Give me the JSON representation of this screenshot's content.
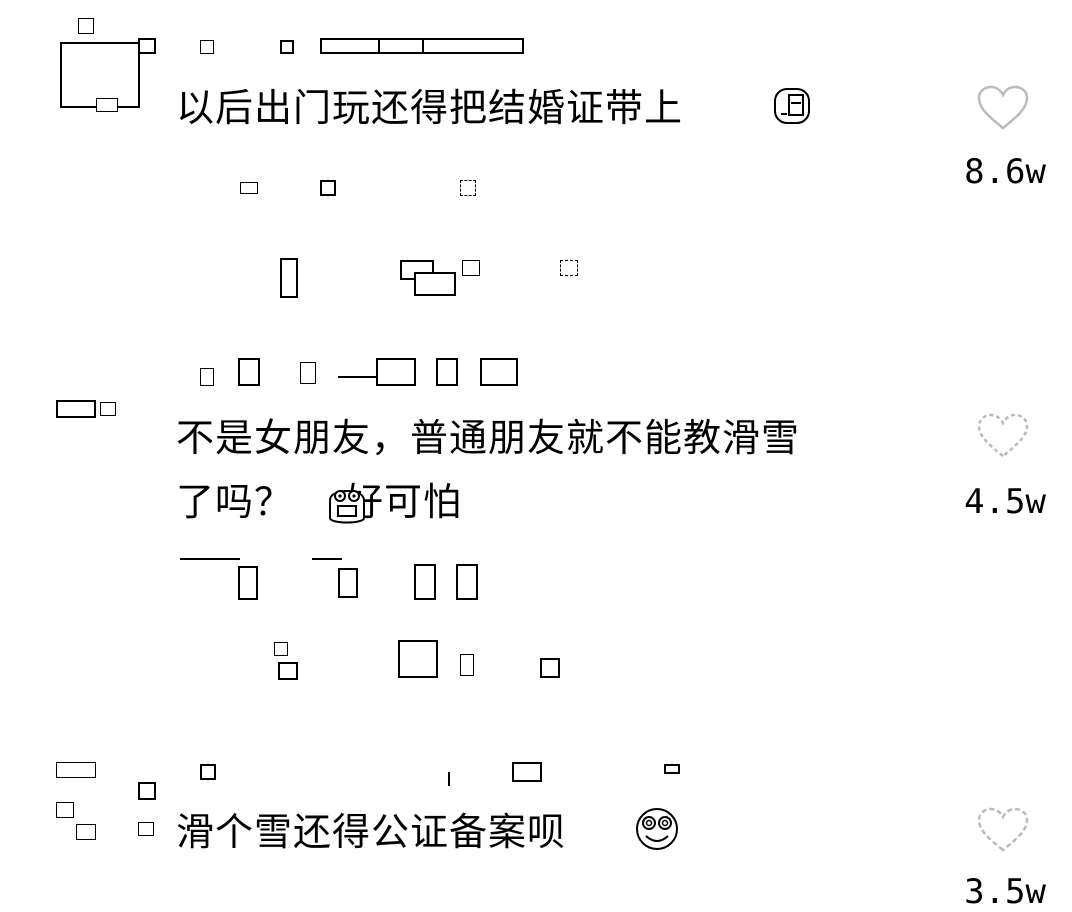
{
  "comments": [
    {
      "text_line1": "以后出门玩还得把结婚证带上",
      "likes": "8.6w"
    },
    {
      "text_line1": "不是女朋友，普通朋友就不能教滑雪",
      "text_line2": "了吗？",
      "text_suffix": "好可怕",
      "likes": "4.5w"
    },
    {
      "text_line1": "滑个雪还得公证备案呗",
      "likes": "3.5w"
    }
  ],
  "icons": {
    "like": "heart-outline-icon",
    "emoji_1": "cover-face-emoji",
    "emoji_2": "scared-face-emoji",
    "emoji_3": "dizzy-face-emoji"
  },
  "colors": {
    "text": "#000000",
    "background": "#ffffff",
    "heart_stroke": "#bbbbbb"
  }
}
